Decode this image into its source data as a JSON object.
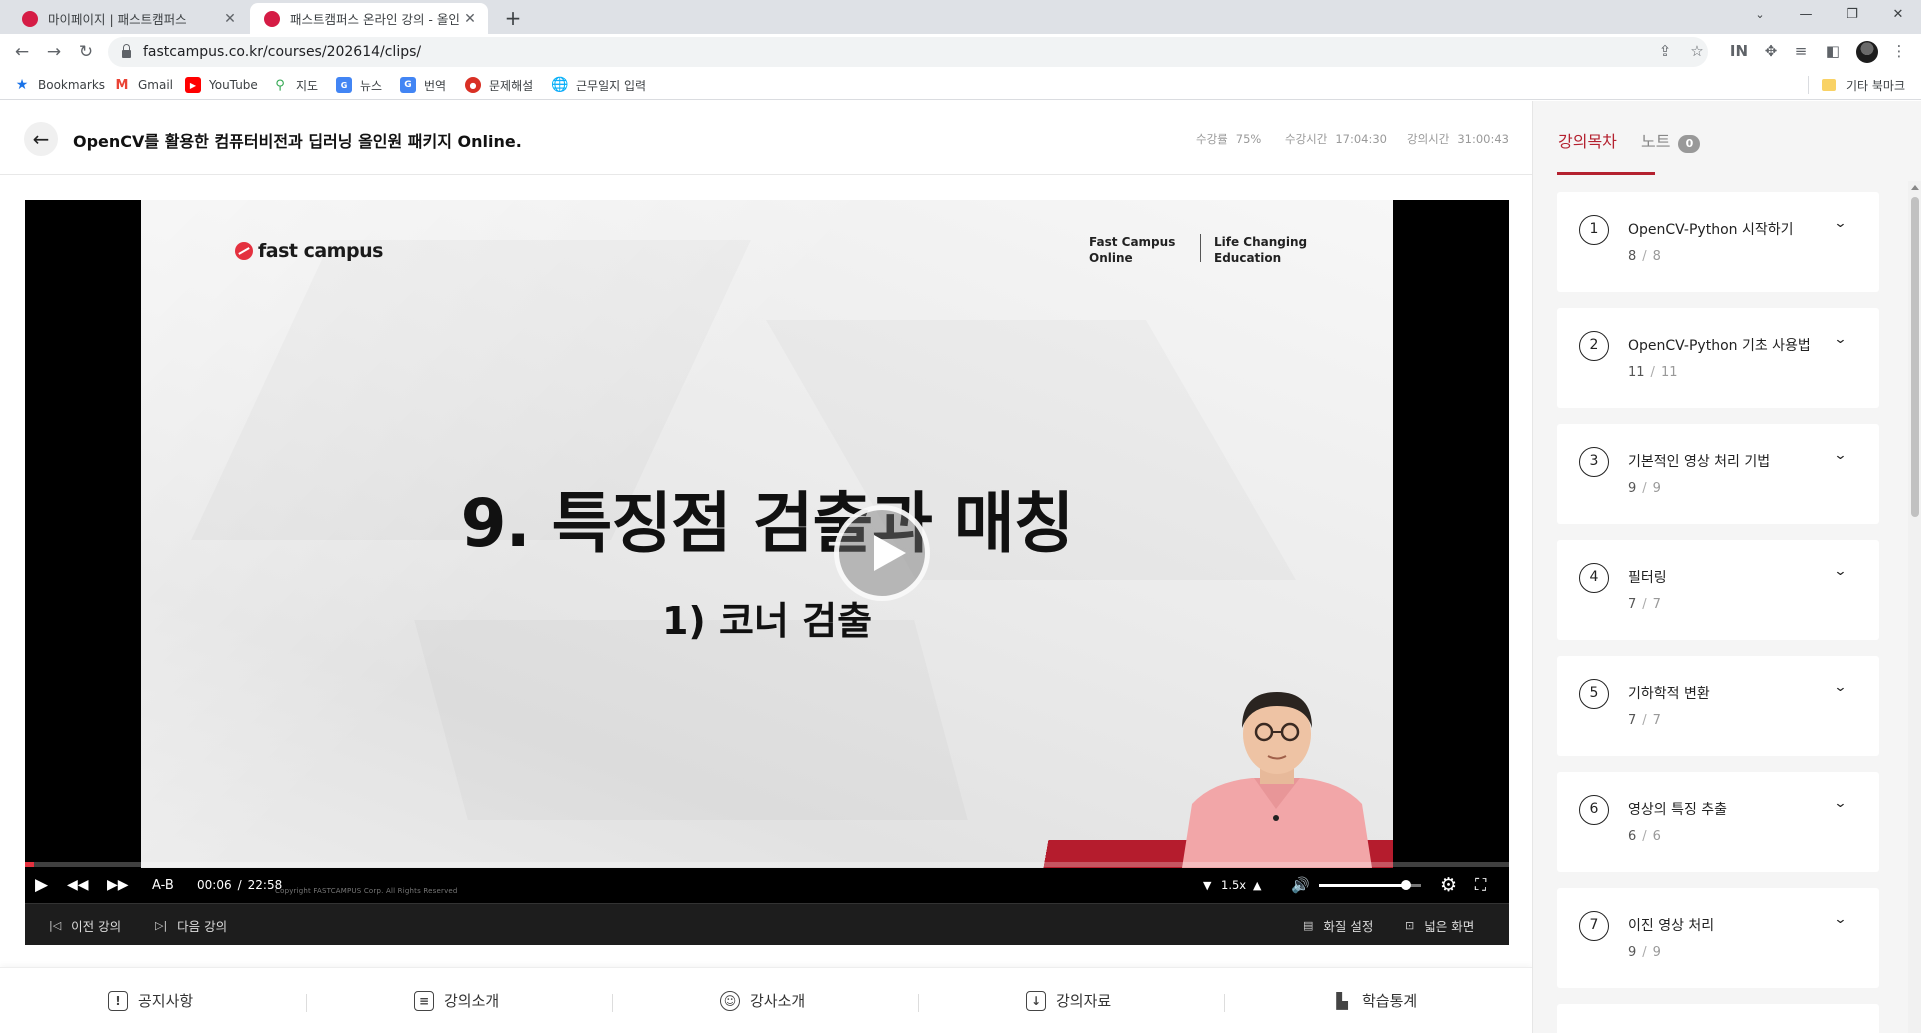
{
  "browser": {
    "tabs": [
      {
        "title": "마이페이지 | 패스트캠퍼스",
        "active": false
      },
      {
        "title": "패스트캠퍼스 온라인 강의 - 올인",
        "active": true
      }
    ],
    "url": "fastcampus.co.kr/courses/202614/clips/",
    "bookmarks": [
      {
        "label": "Bookmarks",
        "icon": "star-icon",
        "color": "#1a73e8"
      },
      {
        "label": "Gmail",
        "icon": "gmail-icon",
        "color": "#ea4335"
      },
      {
        "label": "YouTube",
        "icon": "youtube-icon",
        "color": "#ff0000"
      },
      {
        "label": "지도",
        "icon": "maps-icon",
        "color": "#34a853"
      },
      {
        "label": "뉴스",
        "icon": "news-icon",
        "color": "#4285f4"
      },
      {
        "label": "번역",
        "icon": "translate-icon",
        "color": "#4285f4"
      },
      {
        "label": "문제해설",
        "icon": "bookmark-site-icon",
        "color": "#d93025"
      },
      {
        "label": "근무일지 입력",
        "icon": "globe-icon",
        "color": "#5f6368"
      }
    ],
    "other_bookmarks": "기타 북마크"
  },
  "header": {
    "course_title": "OpenCV를 활용한 컴퓨터비전과 딥러닝 올인원 패키지 Online.",
    "stats": [
      {
        "label": "수강률",
        "value": "75%"
      },
      {
        "label": "수강시간",
        "value": "17:04:30"
      },
      {
        "label": "강의시간",
        "value": "31:00:43"
      }
    ]
  },
  "video": {
    "slide": {
      "logo": "fast campus",
      "tag1": [
        "Fast Campus",
        "Online"
      ],
      "tag2": [
        "Life Changing",
        "Education"
      ],
      "title": "9. 특징점 검출과 매칭",
      "subtitle": "1) 코너 검출",
      "copyright": "Copyright FASTCAMPUS Corp. All Rights Reserved"
    },
    "progress": 0.005,
    "controls": {
      "ab": "A-B",
      "current_time": "00:06",
      "separator": "/",
      "duration": "22:58",
      "speed": "1.5x",
      "volume": 0.85
    },
    "sub": {
      "prev": "이전 강의",
      "next": "다음 강의",
      "quality": "화질 설정",
      "wide": "넓은 화면"
    }
  },
  "bottom_nav": [
    {
      "label": "공지사항",
      "icon": "notice-icon"
    },
    {
      "label": "강의소개",
      "icon": "clipboard-icon"
    },
    {
      "label": "강사소개",
      "icon": "user-circle-icon"
    },
    {
      "label": "강의자료",
      "icon": "download-doc-icon"
    },
    {
      "label": "학습통계",
      "icon": "bar-chart-icon"
    }
  ],
  "sidebar": {
    "tabs": {
      "curriculum": "강의목차",
      "notes": "노트",
      "notes_count": "0"
    },
    "chapters": [
      {
        "num": "1",
        "title": "OpenCV-Python 시작하기",
        "done": "8",
        "total": "8"
      },
      {
        "num": "2",
        "title": "OpenCV-Python 기초 사용법",
        "done": "11",
        "total": "11"
      },
      {
        "num": "3",
        "title": "기본적인 영상 처리 기법",
        "done": "9",
        "total": "9"
      },
      {
        "num": "4",
        "title": "필터링",
        "done": "7",
        "total": "7"
      },
      {
        "num": "5",
        "title": "기하학적 변환",
        "done": "7",
        "total": "7"
      },
      {
        "num": "6",
        "title": "영상의 특징 추출",
        "done": "6",
        "total": "6"
      },
      {
        "num": "7",
        "title": "이진 영상 처리",
        "done": "9",
        "total": "9"
      }
    ]
  }
}
